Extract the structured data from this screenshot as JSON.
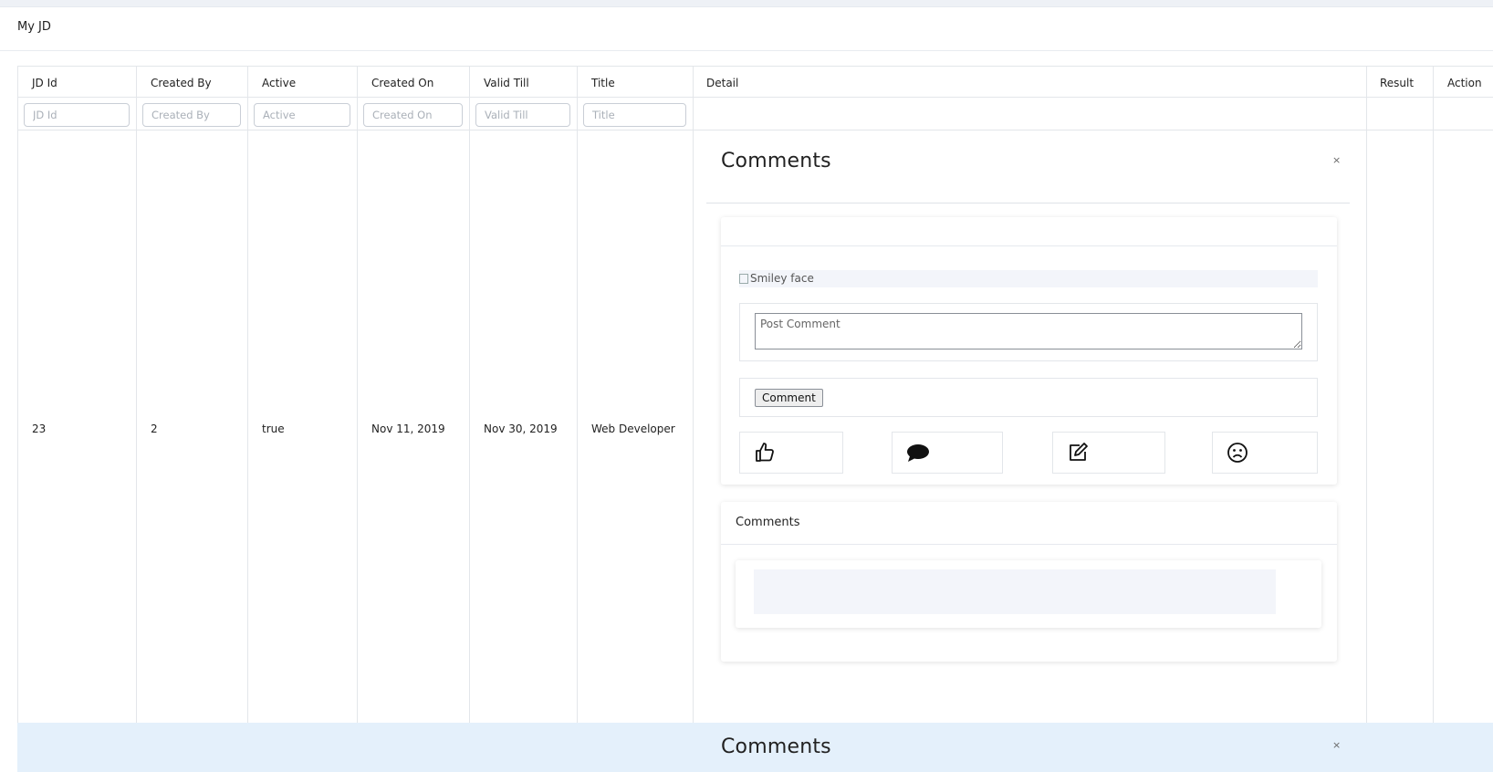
{
  "page": {
    "title": "My JD"
  },
  "table": {
    "columns": [
      "JD Id",
      "Created By",
      "Active",
      "Created On",
      "Valid Till",
      "Title",
      "Detail",
      "Result",
      "Action"
    ],
    "filters": [
      {
        "placeholder": "JD Id"
      },
      {
        "placeholder": "Created By"
      },
      {
        "placeholder": "Active"
      },
      {
        "placeholder": "Created On"
      },
      {
        "placeholder": "Valid Till"
      },
      {
        "placeholder": "Title"
      }
    ],
    "rows": [
      {
        "jd_id": "23",
        "created_by": "2",
        "active": "true",
        "created_on": "Nov 11, 2019",
        "valid_till": "Nov 30, 2019",
        "title": "Web Developer"
      }
    ]
  },
  "detail": {
    "heading": "Comments",
    "close": "×",
    "image_alt": "Smiley face",
    "comment_placeholder": "Post Comment",
    "comment_button": "Comment",
    "reactions": [
      "thumbs-up-icon",
      "comment-icon",
      "edit-icon",
      "frown-icon"
    ],
    "comments_section_title": "Comments"
  },
  "row2": {
    "heading": "Comments",
    "close": "×"
  },
  "colors": {
    "page_bg": "#eef1f6",
    "border": "#e3e6ea",
    "selected_row": "#e4f0fb"
  }
}
